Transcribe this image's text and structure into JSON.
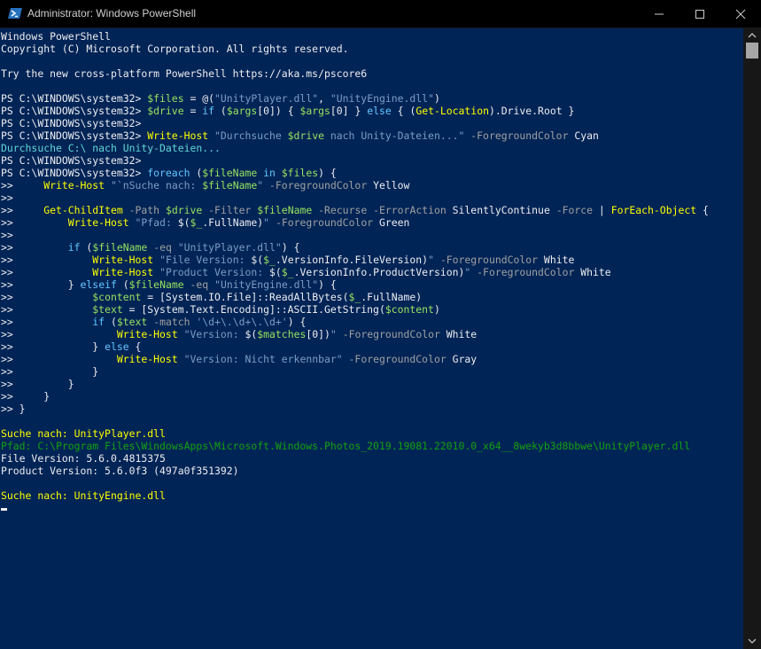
{
  "window": {
    "title": "Administrator: Windows PowerShell",
    "icon": "powershell-icon",
    "controls": [
      "minimize-icon",
      "maximize-icon",
      "close-icon"
    ]
  },
  "colors": {
    "background": "#012456",
    "text": "#eeedf0",
    "command": "#ffff00",
    "variable": "#98e35e",
    "string": "#7a9dc6",
    "parameter": "#a0a0a0",
    "keyword": "#62c6ff",
    "cyan_output": "#61d6d6",
    "green_output": "#13a10e"
  },
  "console": {
    "lines": [
      [
        {
          "t": "Windows PowerShell",
          "c": "c"
        }
      ],
      [
        {
          "t": "Copyright (C) Microsoft Corporation. All rights reserved.",
          "c": "c"
        }
      ],
      [
        {
          "t": "",
          "c": "c"
        }
      ],
      [
        {
          "t": "Try the new cross-platform PowerShell https://aka.ms/pscore6",
          "c": "c"
        }
      ],
      [
        {
          "t": "",
          "c": "c"
        }
      ],
      [
        {
          "t": "PS C:\\WINDOWS\\system32> ",
          "c": "c"
        },
        {
          "t": "$files",
          "c": "v"
        },
        {
          "t": " = @(",
          "c": "c"
        },
        {
          "t": "\"UnityPlayer.dll\"",
          "c": "s"
        },
        {
          "t": ", ",
          "c": "c"
        },
        {
          "t": "\"UnityEngine.dll\"",
          "c": "s"
        },
        {
          "t": ")",
          "c": "c"
        }
      ],
      [
        {
          "t": "PS C:\\WINDOWS\\system32> ",
          "c": "c"
        },
        {
          "t": "$drive",
          "c": "v"
        },
        {
          "t": " = ",
          "c": "c"
        },
        {
          "t": "if",
          "c": "k"
        },
        {
          "t": " (",
          "c": "c"
        },
        {
          "t": "$args",
          "c": "v"
        },
        {
          "t": "[0]) { ",
          "c": "c"
        },
        {
          "t": "$args",
          "c": "v"
        },
        {
          "t": "[0] } ",
          "c": "c"
        },
        {
          "t": "else",
          "c": "k"
        },
        {
          "t": " { (",
          "c": "c"
        },
        {
          "t": "Get-Location",
          "c": "y"
        },
        {
          "t": ").Drive.Root }",
          "c": "c"
        }
      ],
      [
        {
          "t": "PS C:\\WINDOWS\\system32>",
          "c": "c"
        }
      ],
      [
        {
          "t": "PS C:\\WINDOWS\\system32> ",
          "c": "c"
        },
        {
          "t": "Write-Host",
          "c": "y"
        },
        {
          "t": " ",
          "c": "c"
        },
        {
          "t": "\"Durchsuche ",
          "c": "s"
        },
        {
          "t": "$drive",
          "c": "v"
        },
        {
          "t": " nach Unity-Dateien...\"",
          "c": "s"
        },
        {
          "t": " ",
          "c": "c"
        },
        {
          "t": "-ForegroundColor",
          "c": "p"
        },
        {
          "t": " Cyan",
          "c": "c"
        }
      ],
      [
        {
          "t": "Durchsuche C:\\ nach Unity-Dateien...",
          "c": "cy"
        }
      ],
      [
        {
          "t": "PS C:\\WINDOWS\\system32>",
          "c": "c"
        }
      ],
      [
        {
          "t": "PS C:\\WINDOWS\\system32> ",
          "c": "c"
        },
        {
          "t": "foreach",
          "c": "k"
        },
        {
          "t": " (",
          "c": "c"
        },
        {
          "t": "$fileName",
          "c": "v"
        },
        {
          "t": " ",
          "c": "c"
        },
        {
          "t": "in",
          "c": "k"
        },
        {
          "t": " ",
          "c": "c"
        },
        {
          "t": "$files",
          "c": "v"
        },
        {
          "t": ") {",
          "c": "c"
        }
      ],
      [
        {
          "t": ">>     ",
          "c": "c"
        },
        {
          "t": "Write-Host",
          "c": "y"
        },
        {
          "t": " ",
          "c": "c"
        },
        {
          "t": "\"`nSuche nach: ",
          "c": "s"
        },
        {
          "t": "$fileName",
          "c": "v"
        },
        {
          "t": "\"",
          "c": "s"
        },
        {
          "t": " ",
          "c": "c"
        },
        {
          "t": "-ForegroundColor",
          "c": "p"
        },
        {
          "t": " Yellow",
          "c": "c"
        }
      ],
      [
        {
          "t": ">>",
          "c": "c"
        }
      ],
      [
        {
          "t": ">>     ",
          "c": "c"
        },
        {
          "t": "Get-ChildItem",
          "c": "y"
        },
        {
          "t": " ",
          "c": "c"
        },
        {
          "t": "-Path",
          "c": "p"
        },
        {
          "t": " ",
          "c": "c"
        },
        {
          "t": "$drive",
          "c": "v"
        },
        {
          "t": " ",
          "c": "c"
        },
        {
          "t": "-Filter",
          "c": "p"
        },
        {
          "t": " ",
          "c": "c"
        },
        {
          "t": "$fileName",
          "c": "v"
        },
        {
          "t": " ",
          "c": "c"
        },
        {
          "t": "-Recurse",
          "c": "p"
        },
        {
          "t": " ",
          "c": "c"
        },
        {
          "t": "-ErrorAction",
          "c": "p"
        },
        {
          "t": " SilentlyContinue ",
          "c": "c"
        },
        {
          "t": "-Force",
          "c": "p"
        },
        {
          "t": " | ",
          "c": "c"
        },
        {
          "t": "ForEach-Object",
          "c": "y"
        },
        {
          "t": " {",
          "c": "c"
        }
      ],
      [
        {
          "t": ">>         ",
          "c": "c"
        },
        {
          "t": "Write-Host",
          "c": "y"
        },
        {
          "t": " ",
          "c": "c"
        },
        {
          "t": "\"Pfad: ",
          "c": "s"
        },
        {
          "t": "$(",
          "c": "c"
        },
        {
          "t": "$_",
          "c": "v"
        },
        {
          "t": ".FullName)",
          "c": "c"
        },
        {
          "t": "\"",
          "c": "s"
        },
        {
          "t": " ",
          "c": "c"
        },
        {
          "t": "-ForegroundColor",
          "c": "p"
        },
        {
          "t": " Green",
          "c": "c"
        }
      ],
      [
        {
          "t": ">>",
          "c": "c"
        }
      ],
      [
        {
          "t": ">>         ",
          "c": "c"
        },
        {
          "t": "if",
          "c": "k"
        },
        {
          "t": " (",
          "c": "c"
        },
        {
          "t": "$fileName",
          "c": "v"
        },
        {
          "t": " ",
          "c": "c"
        },
        {
          "t": "-eq",
          "c": "p"
        },
        {
          "t": " ",
          "c": "c"
        },
        {
          "t": "\"UnityPlayer.dll\"",
          "c": "s"
        },
        {
          "t": ") {",
          "c": "c"
        }
      ],
      [
        {
          "t": ">>             ",
          "c": "c"
        },
        {
          "t": "Write-Host",
          "c": "y"
        },
        {
          "t": " ",
          "c": "c"
        },
        {
          "t": "\"File Version: ",
          "c": "s"
        },
        {
          "t": "$(",
          "c": "c"
        },
        {
          "t": "$_",
          "c": "v"
        },
        {
          "t": ".VersionInfo.FileVersion)",
          "c": "c"
        },
        {
          "t": "\"",
          "c": "s"
        },
        {
          "t": " ",
          "c": "c"
        },
        {
          "t": "-ForegroundColor",
          "c": "p"
        },
        {
          "t": " White",
          "c": "c"
        }
      ],
      [
        {
          "t": ">>             ",
          "c": "c"
        },
        {
          "t": "Write-Host",
          "c": "y"
        },
        {
          "t": " ",
          "c": "c"
        },
        {
          "t": "\"Product Version: ",
          "c": "s"
        },
        {
          "t": "$(",
          "c": "c"
        },
        {
          "t": "$_",
          "c": "v"
        },
        {
          "t": ".VersionInfo.ProductVersion)",
          "c": "c"
        },
        {
          "t": "\"",
          "c": "s"
        },
        {
          "t": " ",
          "c": "c"
        },
        {
          "t": "-ForegroundColor",
          "c": "p"
        },
        {
          "t": " White",
          "c": "c"
        }
      ],
      [
        {
          "t": ">>         } ",
          "c": "c"
        },
        {
          "t": "elseif",
          "c": "k"
        },
        {
          "t": " (",
          "c": "c"
        },
        {
          "t": "$fileName",
          "c": "v"
        },
        {
          "t": " ",
          "c": "c"
        },
        {
          "t": "-eq",
          "c": "p"
        },
        {
          "t": " ",
          "c": "c"
        },
        {
          "t": "\"UnityEngine.dll\"",
          "c": "s"
        },
        {
          "t": ") {",
          "c": "c"
        }
      ],
      [
        {
          "t": ">>             ",
          "c": "c"
        },
        {
          "t": "$content",
          "c": "v"
        },
        {
          "t": " = [System.IO.File]::ReadAllBytes(",
          "c": "c"
        },
        {
          "t": "$_",
          "c": "v"
        },
        {
          "t": ".FullName)",
          "c": "c"
        }
      ],
      [
        {
          "t": ">>             ",
          "c": "c"
        },
        {
          "t": "$text",
          "c": "v"
        },
        {
          "t": " = [System.Text.Encoding]::ASCII.GetString(",
          "c": "c"
        },
        {
          "t": "$content",
          "c": "v"
        },
        {
          "t": ")",
          "c": "c"
        }
      ],
      [
        {
          "t": ">>             ",
          "c": "c"
        },
        {
          "t": "if",
          "c": "k"
        },
        {
          "t": " (",
          "c": "c"
        },
        {
          "t": "$text",
          "c": "v"
        },
        {
          "t": " ",
          "c": "c"
        },
        {
          "t": "-match",
          "c": "p"
        },
        {
          "t": " ",
          "c": "c"
        },
        {
          "t": "'\\d+\\.\\d+\\.\\d+'",
          "c": "s"
        },
        {
          "t": ") {",
          "c": "c"
        }
      ],
      [
        {
          "t": ">>                 ",
          "c": "c"
        },
        {
          "t": "Write-Host",
          "c": "y"
        },
        {
          "t": " ",
          "c": "c"
        },
        {
          "t": "\"Version: ",
          "c": "s"
        },
        {
          "t": "$(",
          "c": "c"
        },
        {
          "t": "$matches",
          "c": "v"
        },
        {
          "t": "[0])",
          "c": "c"
        },
        {
          "t": "\"",
          "c": "s"
        },
        {
          "t": " ",
          "c": "c"
        },
        {
          "t": "-ForegroundColor",
          "c": "p"
        },
        {
          "t": " White",
          "c": "c"
        }
      ],
      [
        {
          "t": ">>             } ",
          "c": "c"
        },
        {
          "t": "else",
          "c": "k"
        },
        {
          "t": " {",
          "c": "c"
        }
      ],
      [
        {
          "t": ">>                 ",
          "c": "c"
        },
        {
          "t": "Write-Host",
          "c": "y"
        },
        {
          "t": " ",
          "c": "c"
        },
        {
          "t": "\"Version: Nicht erkennbar\"",
          "c": "s"
        },
        {
          "t": " ",
          "c": "c"
        },
        {
          "t": "-ForegroundColor",
          "c": "p"
        },
        {
          "t": " Gray",
          "c": "c"
        }
      ],
      [
        {
          "t": ">>             }",
          "c": "c"
        }
      ],
      [
        {
          "t": ">>         }",
          "c": "c"
        }
      ],
      [
        {
          "t": ">>     }",
          "c": "c"
        }
      ],
      [
        {
          "t": ">> }",
          "c": "c"
        }
      ],
      [
        {
          "t": "",
          "c": "c"
        }
      ],
      [
        {
          "t": "Suche nach: UnityPlayer.dll",
          "c": "y"
        }
      ],
      [
        {
          "t": "Pfad: C:\\Program Files\\WindowsApps\\Microsoft.Windows.Photos_2019.19081.22010.0_x64__8wekyb3d8bbwe\\UnityPlayer.dll",
          "c": "gr"
        }
      ],
      [
        {
          "t": "File Version: 5.6.0.4815375",
          "c": "c"
        }
      ],
      [
        {
          "t": "Product Version: 5.6.0f3 (497a0f351392)",
          "c": "c"
        }
      ],
      [
        {
          "t": "",
          "c": "c"
        }
      ],
      [
        {
          "t": "Suche nach: UnityEngine.dll",
          "c": "y"
        }
      ]
    ]
  }
}
